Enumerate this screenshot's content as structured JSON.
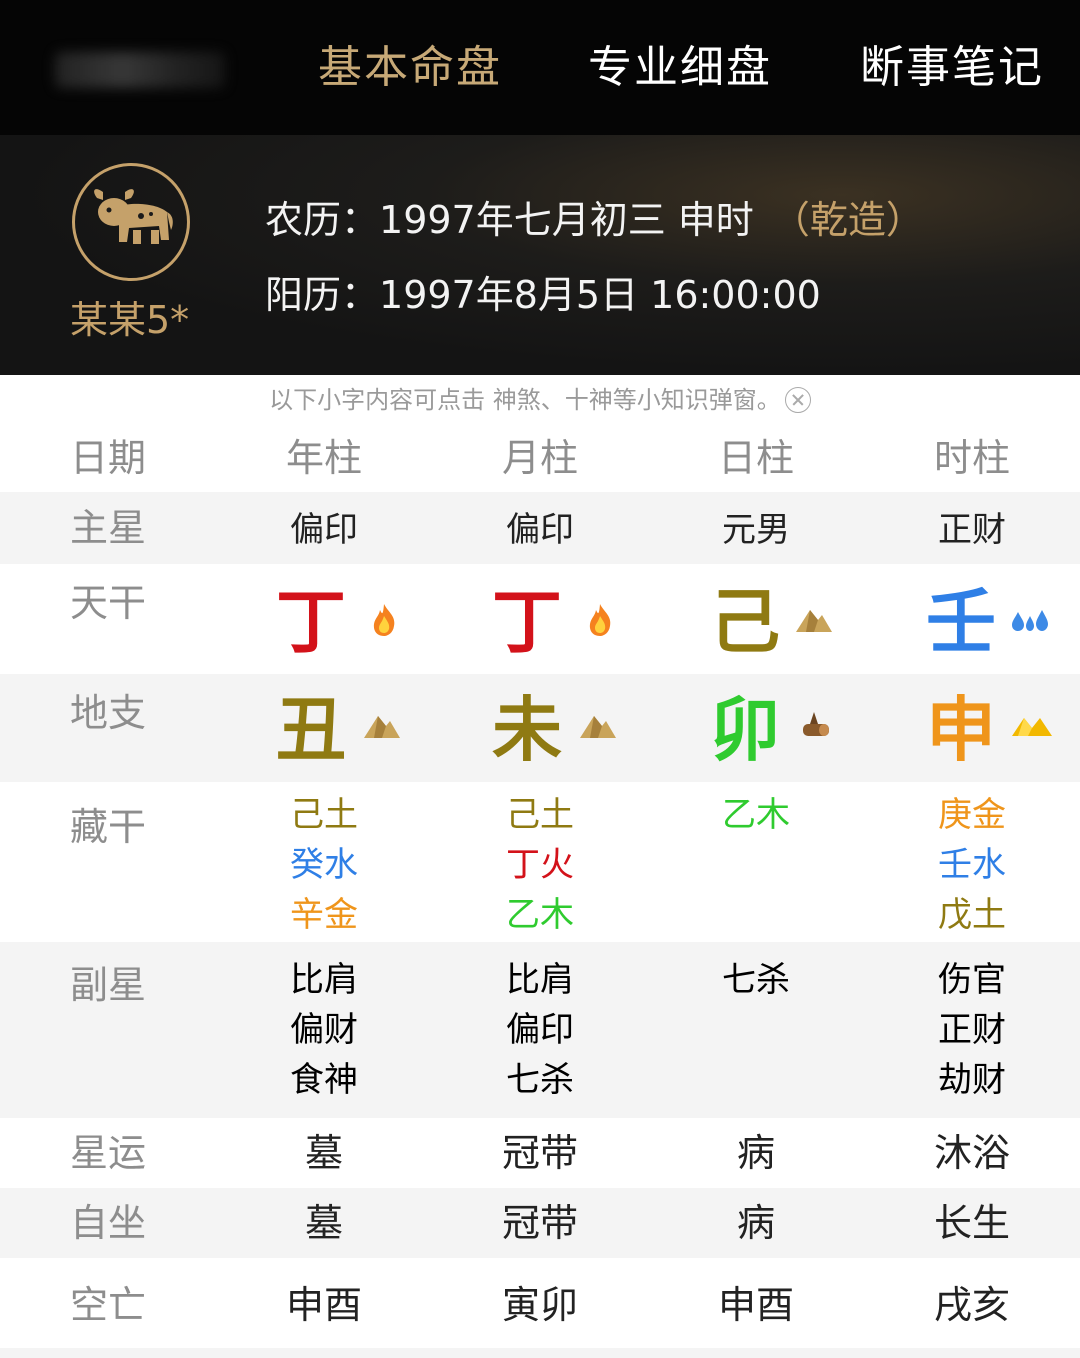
{
  "nav": {
    "tabs": [
      "基本命盘",
      "专业细盘",
      "断事笔记"
    ]
  },
  "profile": {
    "zodiac_icon": "ox-icon",
    "username": "某某5*",
    "lunar_label": "农历：",
    "lunar_date": "1997年七月初三 申时",
    "gender_tag": "（乾造）",
    "solar_label": "阳历：",
    "solar_date": "1997年8月5日 16:00:00"
  },
  "tip": "以下小字内容可点击 神煞、十神等小知识弹窗。",
  "table": {
    "header": {
      "label": "日期",
      "cols": [
        "年柱",
        "月柱",
        "日柱",
        "时柱"
      ]
    },
    "main_star": {
      "label": "主星",
      "cols": [
        "偏印",
        "偏印",
        "元男",
        "正财"
      ]
    },
    "heavenly_stems": {
      "label": "天干",
      "cols": [
        {
          "char": "丁",
          "color": "#d3121a",
          "icon": "fire-icon"
        },
        {
          "char": "丁",
          "color": "#d3121a",
          "icon": "fire-icon"
        },
        {
          "char": "己",
          "color": "#8f7a12",
          "icon": "earth-icon"
        },
        {
          "char": "壬",
          "color": "#2f7fe6",
          "icon": "water-icon"
        }
      ]
    },
    "earthly_branches": {
      "label": "地支",
      "cols": [
        {
          "char": "丑",
          "color": "#8f7a12",
          "icon": "earth-icon"
        },
        {
          "char": "未",
          "color": "#8f7a12",
          "icon": "earth-icon"
        },
        {
          "char": "卯",
          "color": "#2fcb2f",
          "icon": "wood-icon"
        },
        {
          "char": "申",
          "color": "#ef951b",
          "icon": "metal-icon"
        }
      ]
    },
    "hidden_stems": {
      "label": "藏干",
      "cols": [
        [
          {
            "text": "己土",
            "color": "#8f7a12"
          },
          {
            "text": "癸水",
            "color": "#2f7fe6"
          },
          {
            "text": "辛金",
            "color": "#ef951b"
          }
        ],
        [
          {
            "text": "己土",
            "color": "#8f7a12"
          },
          {
            "text": "丁火",
            "color": "#d3121a"
          },
          {
            "text": "乙木",
            "color": "#2fcb2f"
          }
        ],
        [
          {
            "text": "乙木",
            "color": "#2fcb2f"
          }
        ],
        [
          {
            "text": "庚金",
            "color": "#ef951b"
          },
          {
            "text": "壬水",
            "color": "#2f7fe6"
          },
          {
            "text": "戊土",
            "color": "#8f7a12"
          }
        ]
      ]
    },
    "sub_stars": {
      "label": "副星",
      "cols": [
        [
          "比肩",
          "偏财",
          "食神"
        ],
        [
          "比肩",
          "偏印",
          "七杀"
        ],
        [
          "七杀"
        ],
        [
          "伤官",
          "正财",
          "劫财"
        ]
      ]
    },
    "star_luck": {
      "label": "星运",
      "cols": [
        "墓",
        "冠带",
        "病",
        "沐浴"
      ]
    },
    "self_sit": {
      "label": "自坐",
      "cols": [
        "墓",
        "冠带",
        "病",
        "长生"
      ]
    },
    "void": {
      "label": "空亡",
      "cols": [
        "申酉",
        "寅卯",
        "申酉",
        "戌亥"
      ]
    }
  }
}
